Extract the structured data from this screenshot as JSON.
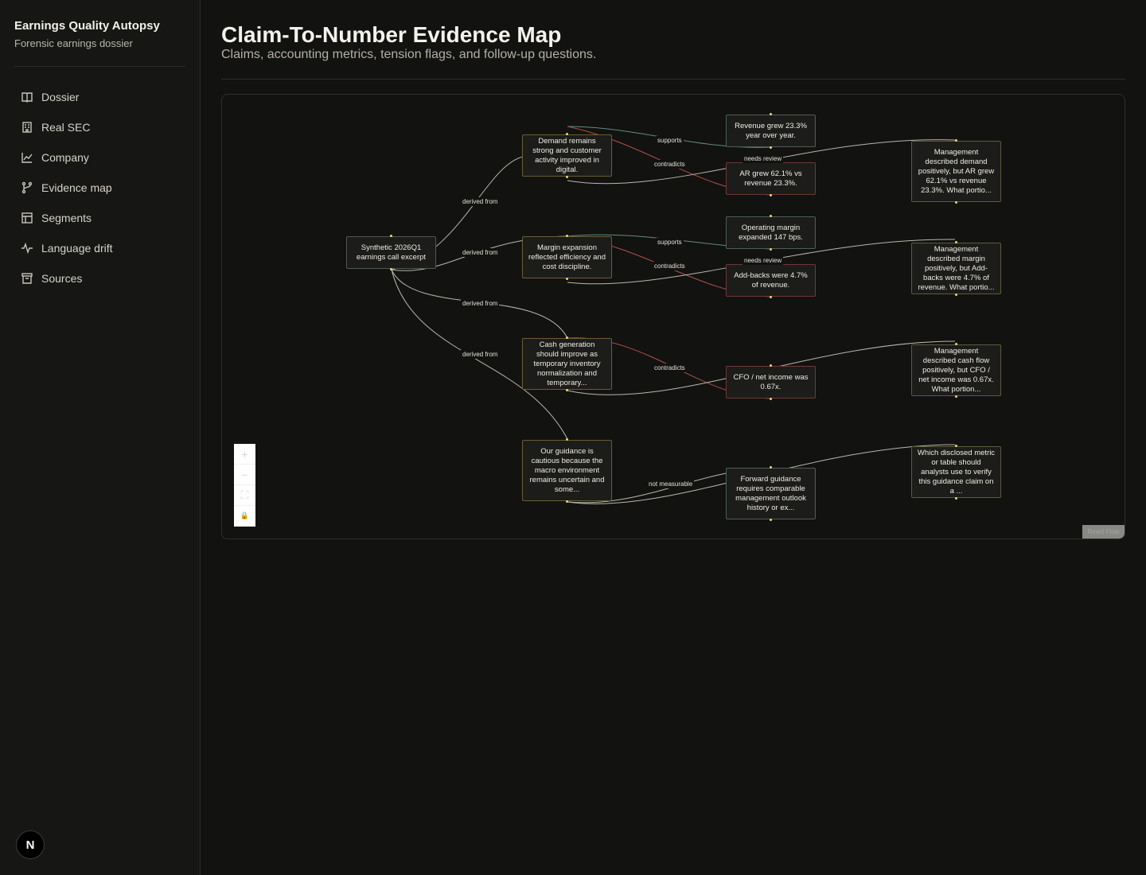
{
  "sidebar": {
    "brand_title": "Earnings Quality Autopsy",
    "brand_subtitle": "Forensic earnings dossier",
    "items": [
      {
        "label": "Dossier",
        "icon": "book-icon"
      },
      {
        "label": "Real SEC",
        "icon": "building-icon"
      },
      {
        "label": "Company",
        "icon": "line-chart-icon"
      },
      {
        "label": "Evidence map",
        "icon": "branch-icon"
      },
      {
        "label": "Segments",
        "icon": "table-icon"
      },
      {
        "label": "Language drift",
        "icon": "pulse-icon"
      },
      {
        "label": "Sources",
        "icon": "archive-icon"
      }
    ],
    "avatar": "N"
  },
  "header": {
    "title": "Claim-To-Number Evidence Map",
    "subtitle": "Claims, accounting metrics, tension flags, and follow-up questions."
  },
  "graph": {
    "source": "Synthetic 2026Q1 earnings call excerpt",
    "claims": [
      "Demand remains strong and customer activity improved in digital.",
      "Margin expansion reflected efficiency and cost discipline.",
      "Cash generation should improve as temporary inventory normalization and temporary...",
      "Our guidance is cautious because the macro environment remains uncertain and some..."
    ],
    "metrics": [
      "Revenue grew 23.3% year over year.",
      "AR grew 62.1% vs revenue 23.3%.",
      "Operating margin expanded 147 bps.",
      "Add-backs were 4.7% of revenue.",
      "CFO / net income was 0.67x.",
      "Forward guidance requires comparable management outlook history or ex..."
    ],
    "questions": [
      "Management described demand positively, but AR grew 62.1% vs revenue 23.3%. What portio...",
      "Management described margin positively, but Add-backs were 4.7% of revenue. What portio...",
      "Management described cash flow positively, but CFO / net income was 0.67x. What portion...",
      "Which disclosed metric or table should analysts use to verify this guidance claim on a ..."
    ],
    "edge_labels": {
      "derived_from": "derived from",
      "supports": "supports",
      "contradicts": "contradicts",
      "needs_review": "needs review",
      "not_measurable": "not measurable"
    },
    "colors": {
      "supports": "#5f8f78",
      "contradicts": "#b0504a",
      "neutral": "#b9b6ad",
      "handle": "#e9d67a"
    },
    "controls": [
      "+",
      "−",
      "⛶",
      "🔒"
    ],
    "attribution": "React Flow"
  }
}
